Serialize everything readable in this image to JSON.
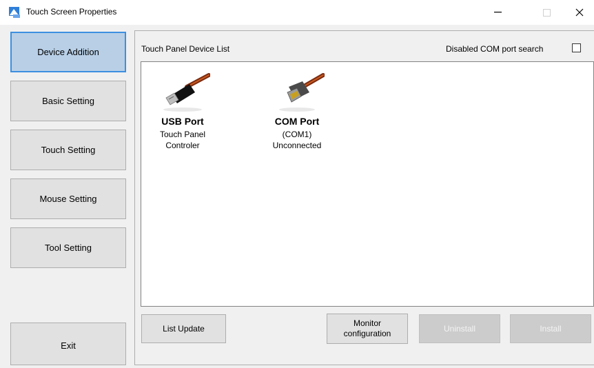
{
  "window": {
    "title": "Touch Screen Properties",
    "controls": {
      "minimize": "—",
      "maximize": "☐",
      "close": "✕"
    }
  },
  "nav": {
    "items": [
      {
        "label": "Device Addition",
        "active": true
      },
      {
        "label": "Basic Setting",
        "active": false
      },
      {
        "label": "Touch Setting",
        "active": false
      },
      {
        "label": "Mouse Setting",
        "active": false
      },
      {
        "label": "Tool Setting",
        "active": false
      }
    ],
    "exit_label": "Exit"
  },
  "main": {
    "list_title": "Touch Panel Device List",
    "com_search_label": "Disabled COM port search",
    "com_search_checked": false,
    "devices": [
      {
        "title": "USB Port",
        "line1": "Touch Panel",
        "line2": "Controler",
        "icon": "usb-cable-icon"
      },
      {
        "title": "COM Port",
        "line1": "(COM1)",
        "line2": "Unconnected",
        "icon": "serial-cable-icon"
      }
    ],
    "buttons": {
      "list_update": "List Update",
      "monitor_config": "Monitor configuration",
      "uninstall": "Uninstall",
      "install": "Install"
    }
  },
  "colors": {
    "active_border": "#3c8fe0",
    "active_bg": "#b8cfe6",
    "button_bg": "#e1e1e1",
    "disabled_bg": "#cccccc"
  }
}
